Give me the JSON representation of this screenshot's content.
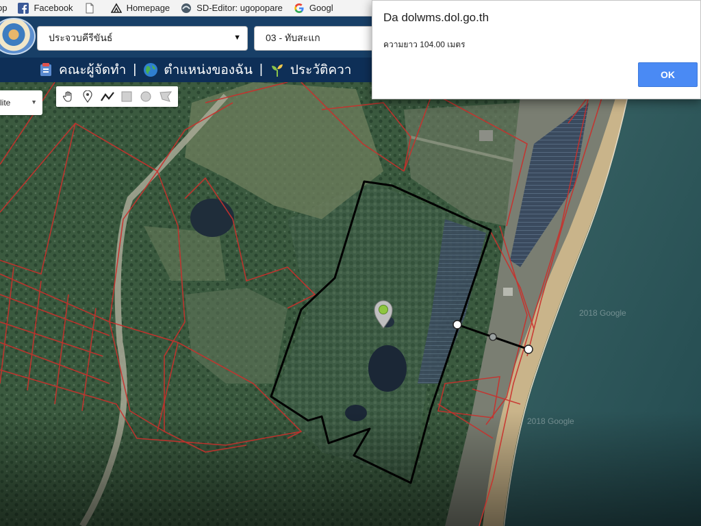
{
  "bookmarks": [
    {
      "label": "pp",
      "icon": "apps-icon"
    },
    {
      "label": "Facebook",
      "icon": "facebook-icon"
    },
    {
      "label": "",
      "icon": "page-icon"
    },
    {
      "label": "Homepage",
      "icon": "homepage-icon"
    },
    {
      "label": "SD-Editor: ugopopare",
      "icon": "sd-editor-icon"
    },
    {
      "label": "Googl",
      "icon": "google-icon"
    }
  ],
  "header": {
    "province_select": "ประจวบคีรีขันธ์",
    "district_select": "03 - ทับสะแก"
  },
  "nav": {
    "items": [
      {
        "label": "คณะผู้จัดทำ",
        "icon": "team-icon"
      },
      {
        "label": "ตำแหน่งของฉัน",
        "icon": "globe-icon"
      },
      {
        "label": "ประวัติควา",
        "icon": "sprout-icon"
      }
    ],
    "separator": "|"
  },
  "map": {
    "map_type_label": "lite",
    "watermarks": [
      "2018 Google",
      "2018 Google"
    ],
    "drawing_tools": [
      "hand-icon",
      "marker-icon",
      "polyline-icon",
      "rectangle-icon",
      "circle-icon",
      "polygon-icon"
    ],
    "colors": {
      "parcel_lines": "#c9302c",
      "measured_plot": "#000000",
      "sea": "#2c5659",
      "beach": "#c9b48a"
    }
  },
  "dialog": {
    "title": "Da dolwms.dol.go.th",
    "message": "ความยาว 104.00 เมตร",
    "ok_label": "OK",
    "accent": "#4a8af4"
  }
}
